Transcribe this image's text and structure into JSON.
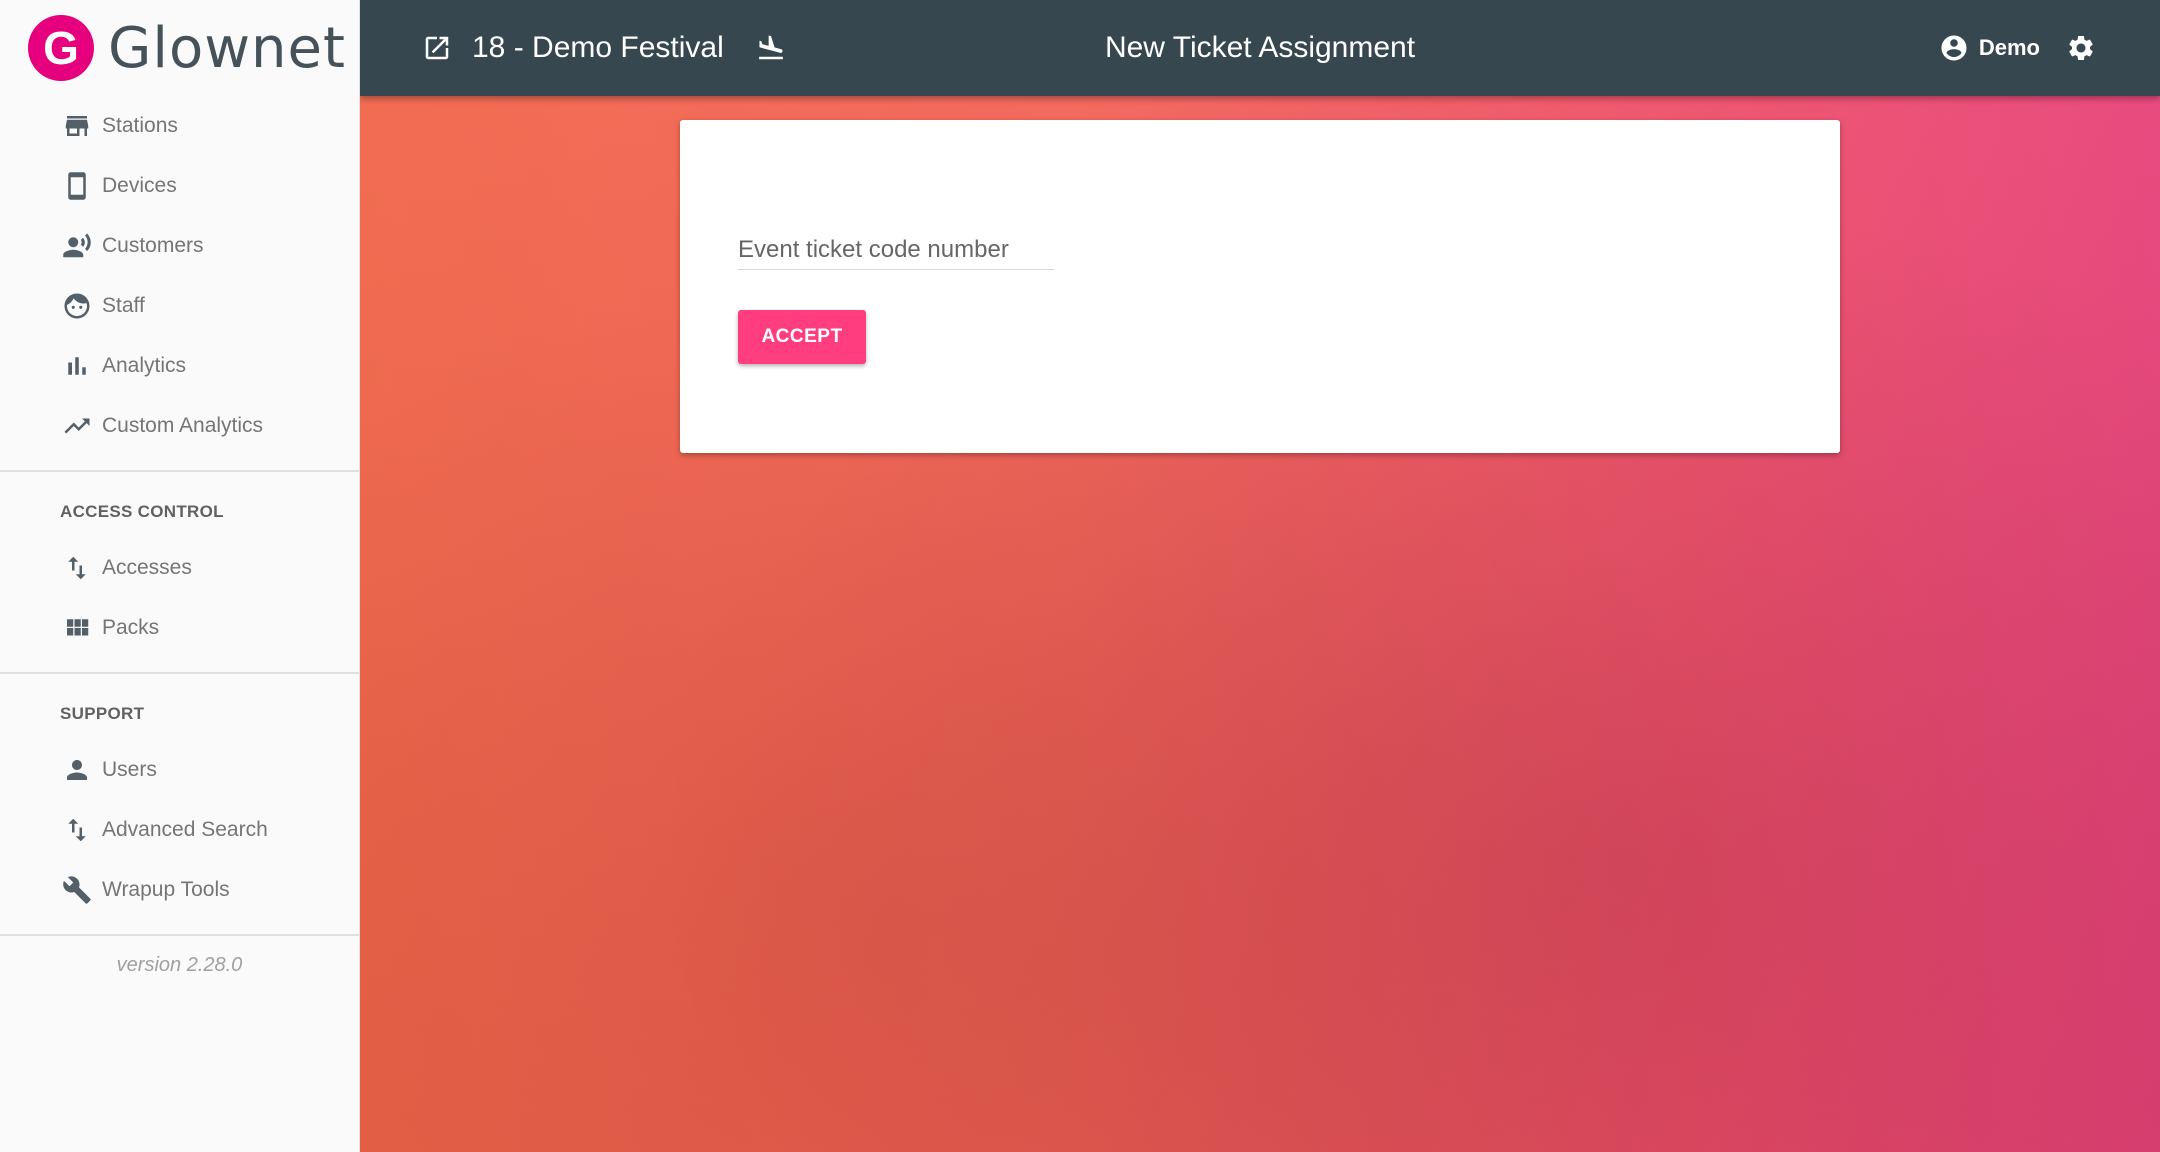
{
  "brand": {
    "logo_letter": "G",
    "name": "Glownet",
    "color": "#e6007e"
  },
  "sidebar": {
    "items": [
      {
        "label": "Stations",
        "icon": "store-icon"
      },
      {
        "label": "Devices",
        "icon": "smartphone-icon"
      },
      {
        "label": "Customers",
        "icon": "record-voice-icon"
      },
      {
        "label": "Staff",
        "icon": "face-icon"
      },
      {
        "label": "Analytics",
        "icon": "bar-chart-icon"
      },
      {
        "label": "Custom Analytics",
        "icon": "trending-up-icon"
      }
    ],
    "access_control": {
      "title": "ACCESS CONTROL",
      "items": [
        {
          "label": "Accesses",
          "icon": "import-export-icon"
        },
        {
          "label": "Packs",
          "icon": "view-module-icon"
        }
      ]
    },
    "support": {
      "title": "SUPPORT",
      "items": [
        {
          "label": "Users",
          "icon": "person-icon"
        },
        {
          "label": "Advanced Search",
          "icon": "import-export-icon"
        },
        {
          "label": "Wrapup Tools",
          "icon": "wrench-icon"
        }
      ]
    },
    "version": "version 2.28.0"
  },
  "topbar": {
    "event_title": "18 - Demo Festival",
    "page_title": "New Ticket Assignment",
    "user_name": "Demo",
    "background": "#37474f"
  },
  "form": {
    "ticket_placeholder": "Event ticket code number",
    "ticket_value": "",
    "accept_label": "ACCEPT",
    "accent": "#ff3d7f"
  }
}
